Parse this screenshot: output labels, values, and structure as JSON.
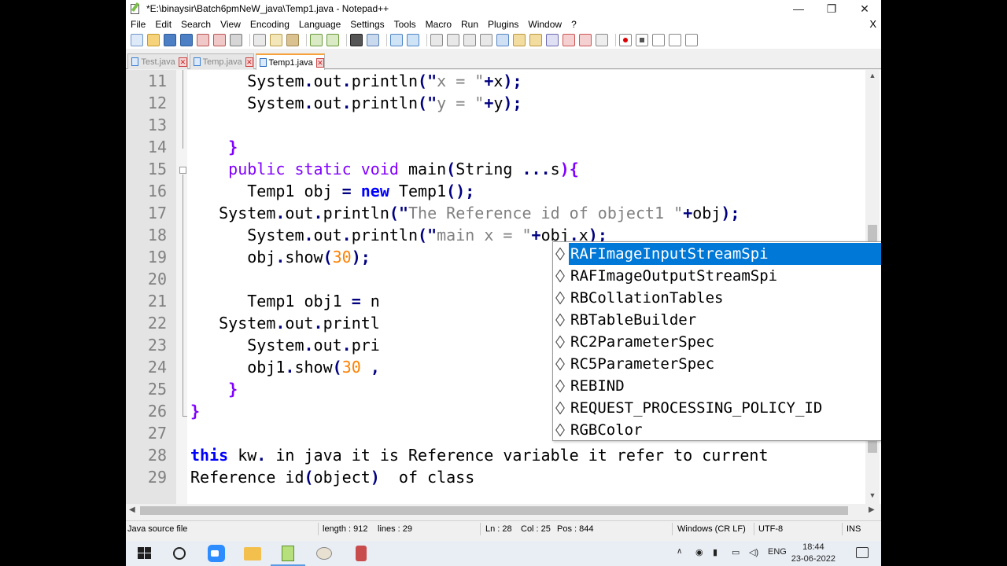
{
  "window": {
    "title": "*E:\\binaysir\\Batch6pmNeW_java\\Temp1.java - Notepad++",
    "minimize": "—",
    "maximize": "❐",
    "close": "✕"
  },
  "menu": {
    "items": [
      "File",
      "Edit",
      "Search",
      "View",
      "Encoding",
      "Language",
      "Settings",
      "Tools",
      "Macro",
      "Run",
      "Plugins",
      "Window",
      "?"
    ],
    "close_doc": "X"
  },
  "tabs": [
    {
      "label": "Test.java",
      "active": false
    },
    {
      "label": "Temp.java",
      "active": false
    },
    {
      "label": "Temp1.java",
      "active": true
    }
  ],
  "editor": {
    "lines": [
      {
        "n": "11",
        "indent": "      ",
        "text": "System.out.println(\"x = \"+x);"
      },
      {
        "n": "12",
        "indent": "      ",
        "text": "System.out.println(\"y = \"+y);"
      },
      {
        "n": "13",
        "indent": "",
        "text": ""
      },
      {
        "n": "14",
        "indent": "    ",
        "text": "}"
      },
      {
        "n": "15",
        "indent": "    ",
        "text": "public static void main(String ...s){"
      },
      {
        "n": "16",
        "indent": "      ",
        "text": "Temp1 obj = new Temp1();"
      },
      {
        "n": "17",
        "indent": "   ",
        "text": "System.out.println(\"The Reference id of object1 \"+obj);"
      },
      {
        "n": "18",
        "indent": "      ",
        "text": "System.out.println(\"main x = \"+obj.x);"
      },
      {
        "n": "19",
        "indent": "      ",
        "text": "obj.show(30);"
      },
      {
        "n": "20",
        "indent": "",
        "text": ""
      },
      {
        "n": "21",
        "indent": "      ",
        "text": "Temp1 obj1 = n"
      },
      {
        "n": "22",
        "indent": "   ",
        "text": "System.out.printl"
      },
      {
        "n": "23",
        "indent": "      ",
        "text": "System.out.pri"
      },
      {
        "n": "24",
        "indent": "      ",
        "text": "obj1.show(30 ,"
      },
      {
        "n": "25",
        "indent": "    ",
        "text": "}"
      },
      {
        "n": "26",
        "indent": "",
        "text": "}"
      },
      {
        "n": "27",
        "indent": "",
        "text": ""
      },
      {
        "n": "28",
        "indent": "",
        "text": "this kw. in java it is Reference variable it refer to current"
      },
      {
        "n": "29",
        "indent": "",
        "text": "Reference id(object)  of class"
      }
    ]
  },
  "autocomplete": {
    "items": [
      "RAFImageInputStreamSpi",
      "RAFImageOutputStreamSpi",
      "RBCollationTables",
      "RBTableBuilder",
      "RC2ParameterSpec",
      "RC5ParameterSpec",
      "REBIND",
      "REQUEST_PROCESSING_POLICY_ID",
      "RGBColor"
    ],
    "selected_index": 0
  },
  "statusbar": {
    "file_type": "Java source file",
    "length": "length : 912",
    "lines": "lines : 29",
    "ln": "Ln : 28",
    "col": "Col : 25",
    "pos": "Pos : 844",
    "eol": "Windows (CR LF)",
    "encoding": "UTF-8",
    "mode": "INS"
  },
  "taskbar": {
    "lang": "ENG",
    "time": "18:44",
    "date": "23-06-2022"
  },
  "colors": {
    "keyword": "#0000ff",
    "type_keyword": "#8000ff",
    "string": "#808080",
    "number": "#ff8000",
    "selection": "#0078d7",
    "active_tab_accent": "#f6a13a"
  }
}
